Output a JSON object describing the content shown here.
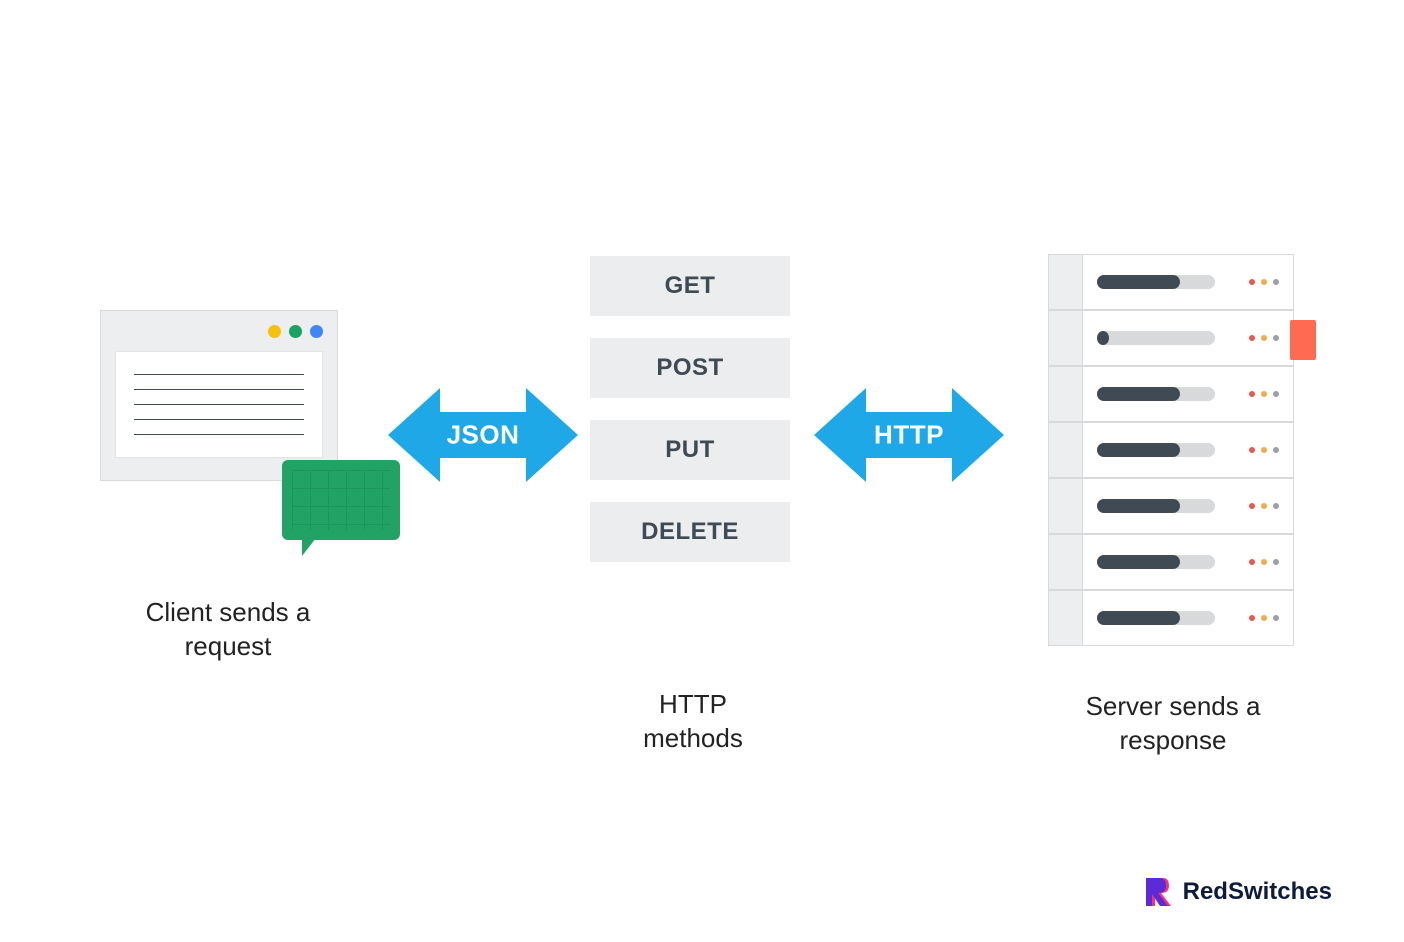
{
  "client": {
    "caption": "Client sends a request"
  },
  "arrow_left": {
    "label": "JSON"
  },
  "methods": {
    "caption": "HTTP methods",
    "list": [
      "GET",
      "POST",
      "PUT",
      "DELETE"
    ]
  },
  "arrow_right": {
    "label": "HTTP"
  },
  "server": {
    "caption": "Server sends a response"
  },
  "brand": {
    "name": "RedSwitches"
  },
  "colors": {
    "arrow": "#1fa8e8",
    "pill_bg": "#ebedee",
    "text": "#3f4a54",
    "chat": "#21a366"
  }
}
